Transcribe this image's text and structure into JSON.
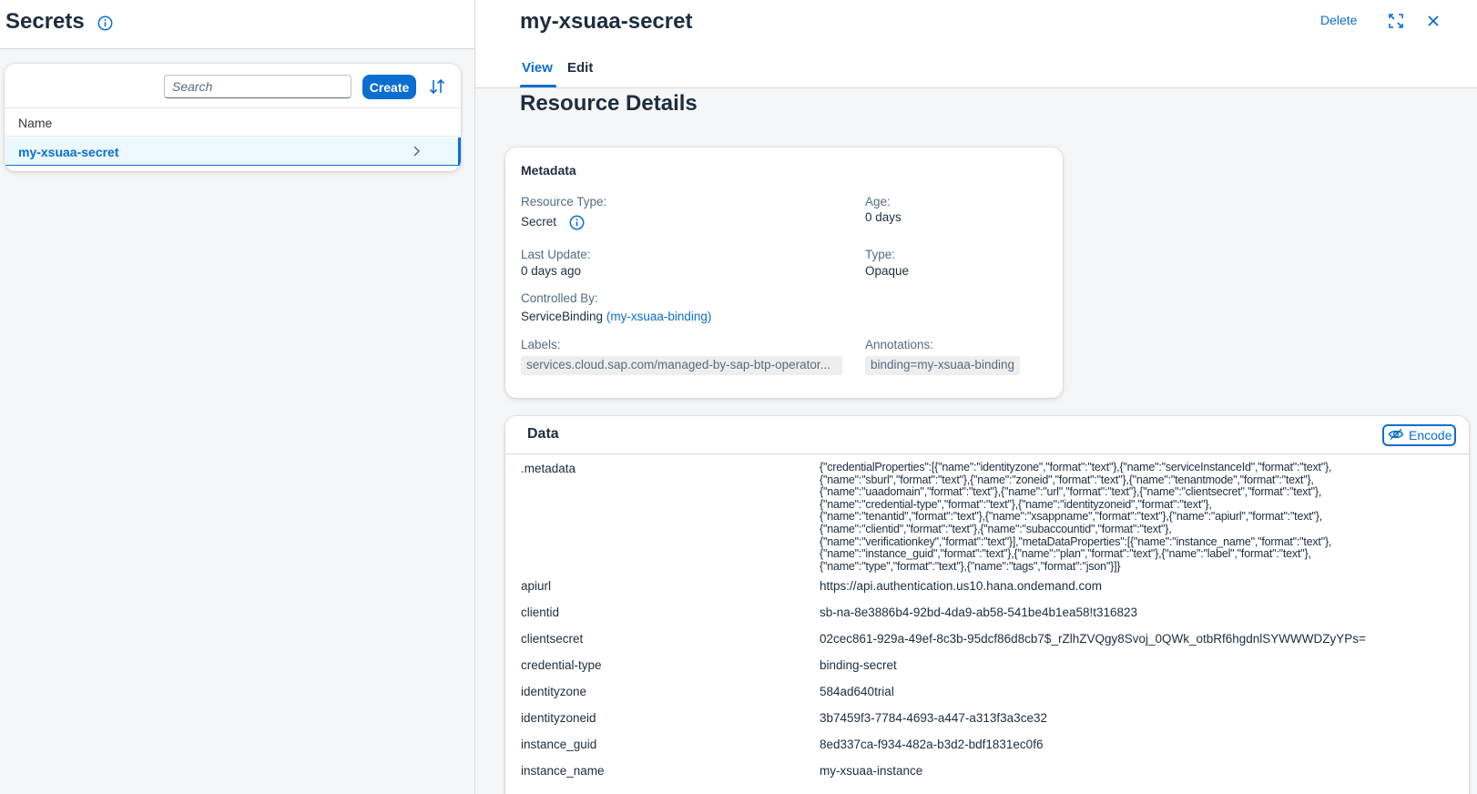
{
  "left": {
    "title": "Secrets",
    "search": {
      "placeholder": "Search",
      "value": ""
    },
    "create_label": "Create",
    "column_header": "Name",
    "rows": [
      {
        "name": "my-xsuaa-secret"
      }
    ]
  },
  "detail": {
    "title": "my-xsuaa-secret",
    "delete_label": "Delete",
    "tabs": [
      {
        "label": "View",
        "selected": true
      },
      {
        "label": "Edit",
        "selected": false
      }
    ],
    "section_title": "Resource Details"
  },
  "metadata": {
    "title": "Metadata",
    "resource_type_label": "Resource Type:",
    "resource_type_value": "Secret",
    "age_label": "Age:",
    "age_value": "0 days",
    "last_update_label": "Last Update:",
    "last_update_value": "0 days ago",
    "type_label": "Type:",
    "type_value": "Opaque",
    "controlled_by_label": "Controlled By:",
    "controlled_by_kind": "ServiceBinding",
    "controlled_by_link": "(my-xsuaa-binding)",
    "labels_label": "Labels:",
    "labels_value": "services.cloud.sap.com/managed-by-sap-btp-operator...",
    "annotations_label": "Annotations:",
    "annotations_value": "binding=my-xsuaa-binding"
  },
  "data": {
    "title": "Data",
    "encode_label": "Encode",
    "metadata_key": ".metadata",
    "metadata_value": "{\"credentialProperties\":[{\"name\":\"identityzone\",\"format\":\"text\"},{\"name\":\"serviceInstanceId\",\"format\":\"text\"},\n{\"name\":\"sburl\",\"format\":\"text\"},{\"name\":\"zoneid\",\"format\":\"text\"},{\"name\":\"tenantmode\",\"format\":\"text\"},\n{\"name\":\"uaadomain\",\"format\":\"text\"},{\"name\":\"url\",\"format\":\"text\"},{\"name\":\"clientsecret\",\"format\":\"text\"},\n{\"name\":\"credential-type\",\"format\":\"text\"},{\"name\":\"identityzoneid\",\"format\":\"text\"},\n{\"name\":\"tenantid\",\"format\":\"text\"},{\"name\":\"xsappname\",\"format\":\"text\"},{\"name\":\"apiurl\",\"format\":\"text\"},\n{\"name\":\"clientid\",\"format\":\"text\"},{\"name\":\"subaccountid\",\"format\":\"text\"},\n{\"name\":\"verificationkey\",\"format\":\"text\"}],\"metaDataProperties\":[{\"name\":\"instance_name\",\"format\":\"text\"},\n{\"name\":\"instance_guid\",\"format\":\"text\"},{\"name\":\"plan\",\"format\":\"text\"},{\"name\":\"label\",\"format\":\"text\"},\n{\"name\":\"type\",\"format\":\"text\"},{\"name\":\"tags\",\"format\":\"json\"}]}",
    "entries": [
      {
        "key": "apiurl",
        "value": "https://api.authentication.us10.hana.ondemand.com"
      },
      {
        "key": "clientid",
        "value": "sb-na-8e3886b4-92bd-4da9-ab58-541be4b1ea58!t316823"
      },
      {
        "key": "clientsecret",
        "value": "02cec861-929a-49ef-8c3b-95dcf86d8cb7$_rZlhZVQgy8Svoj_0QWk_otbRf6hgdnlSYWWWDZyYPs="
      },
      {
        "key": "credential-type",
        "value": "binding-secret"
      },
      {
        "key": "identityzone",
        "value": "584ad640trial"
      },
      {
        "key": "identityzoneid",
        "value": "3b7459f3-7784-4693-a447-a313f3a3ce32"
      },
      {
        "key": "instance_guid",
        "value": "8ed337ca-f934-482a-b3d2-bdf1831ec0f6"
      },
      {
        "key": "instance_name",
        "value": "my-xsuaa-instance"
      }
    ]
  },
  "colors": {
    "accent": "#0a6ed1",
    "text": "#1d2d3e",
    "muted": "#556b82",
    "selected_row": "#ebf8ff"
  }
}
